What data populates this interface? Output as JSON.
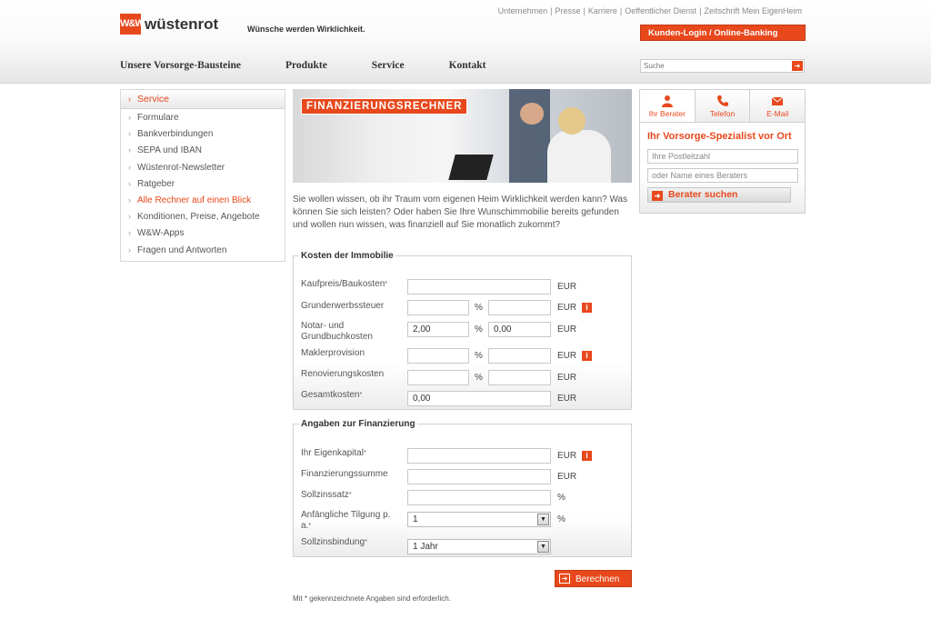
{
  "brand": {
    "logo_mark": "W&W",
    "name": "wüstenrot",
    "slogan": "Wünsche werden Wirklichkeit.",
    "accent": "#e8481c"
  },
  "toplinks": [
    "Unternehmen",
    "Presse",
    "Karriere",
    "Oeffentlicher Dienst",
    "Zeitschrift Mein EigenHeim"
  ],
  "login_label": "Kunden-Login / Online-Banking",
  "mainnav": [
    "Unsere Vorsorge-Bausteine",
    "Produkte",
    "Service",
    "Kontakt"
  ],
  "search": {
    "placeholder": "Suche",
    "go_icon": "arrow-right-icon"
  },
  "sidebar": {
    "active": "Service",
    "items": [
      "Formulare",
      "Bankverbindungen",
      "SEPA und IBAN",
      "Wüstenrot-Newsletter",
      "Ratgeber",
      "Alle Rechner auf einen Blick",
      "Konditionen, Preise, Angebote",
      "W&W-Apps",
      "Fragen und Antworten"
    ]
  },
  "banner_title": "FINANZIERUNGSRECHNER",
  "intro": "Sie wollen wissen, ob ihr Traum vom eigenen Heim Wirklichkeit werden kann? Was können Sie sich leisten? Oder haben Sie Ihre Wunschimmobilie bereits gefunden und wollen nun wissen, was finanziell auf Sie monatlich zukommt?",
  "immobilie": {
    "legend": "Kosten der Immobilie",
    "kaufpreis": "Kaufpreis/Baukosten",
    "grunderwerb": "Grunderwerbssteuer",
    "notar": "Notar- und Grundbuchkosten",
    "notar_pct": "2,00",
    "notar_val": "0,00",
    "makler": "Maklerprovision",
    "renovierung": "Renovierungskosten",
    "gesamt": "Gesamtkosten",
    "gesamt_val": "0,00",
    "eur": "EUR",
    "pct": "%",
    "star": "*",
    "info": "i"
  },
  "finanzierung": {
    "legend": "Angaben zur Finanzierung",
    "eigenkapital": "Ihr Eigenkapital",
    "summe": "Finanzierungssumme",
    "sollzins": "Sollzinssatz",
    "tilgung": "Anfängliche Tilgung p. a.",
    "tilgung_val": "1",
    "bindung": "Sollzinsbindung",
    "bindung_val": "1 Jahr"
  },
  "calc_label": "Berechnen",
  "footnote": "Mit * gekennzeichnete Angaben sind erforderlich.",
  "rpanel": {
    "tabs": [
      {
        "label": "Ihr Berater",
        "icon": "person-icon"
      },
      {
        "label": "Telefon",
        "icon": "phone-icon"
      },
      {
        "label": "E-Mail",
        "icon": "mail-icon"
      }
    ],
    "title": "Ihr Vorsorge-Spezialist vor Ort",
    "plz_placeholder": "Ihre Postleitzahl",
    "name_placeholder": "oder Name eines Beraters",
    "button": "Berater suchen"
  }
}
